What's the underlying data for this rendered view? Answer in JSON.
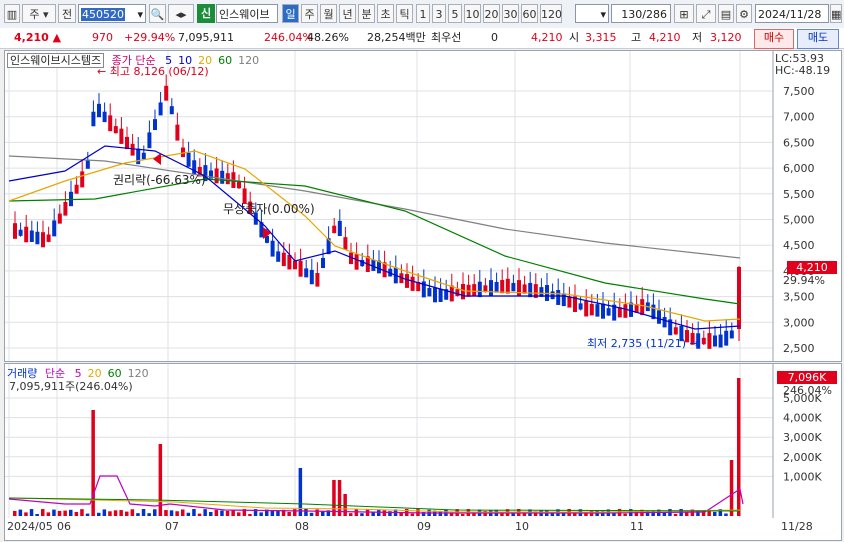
{
  "toolbar": {
    "market_label": "주",
    "scope_label": "전",
    "code": "450520",
    "sin_badge": "신",
    "stock_name": "인스웨이브",
    "periods": [
      "일",
      "주",
      "월",
      "년",
      "분",
      "초",
      "틱"
    ],
    "intervals": [
      "1",
      "3",
      "5",
      "10",
      "20",
      "30",
      "60",
      "120"
    ],
    "count": "130",
    "total": "/286",
    "date": "2024/11/28"
  },
  "quote": {
    "price": "4,210",
    "change": "970",
    "change_pct": "+29.94%",
    "volume": "7,095,911",
    "volume_pct": "246.04%",
    "ratio": "48.26%",
    "amount": "28,254백만",
    "type": "최우선",
    "zero": "0",
    "best": "4,210",
    "open_label": "시",
    "open": "3,315",
    "high_label": "고",
    "high": "4,210",
    "low_label": "저",
    "low": "3,120",
    "buy_label": "매수",
    "sell_label": "매도"
  },
  "price_panel": {
    "title": "인스웨이브시스템즈",
    "ma_label": "종가 단순",
    "ma_periods": [
      {
        "p": "5",
        "color": "#0000cc"
      },
      {
        "p": "10",
        "color": "#0000cc"
      },
      {
        "p": "20",
        "color": "#e6a800"
      },
      {
        "p": "60",
        "color": "#008000"
      },
      {
        "p": "120",
        "color": "#808080"
      }
    ],
    "lc": "LC:53.93",
    "hc": "HC:-48.19",
    "y_ticks": [
      "7,500",
      "7,000",
      "6,500",
      "6,000",
      "5,500",
      "5,000",
      "4,500",
      "4,000",
      "3,500",
      "3,000",
      "2,500"
    ],
    "current_price": "4,210",
    "current_pct": "29.94%",
    "annotations": {
      "high": "최고 8,126 (06/12)",
      "rights": "권리락(-66.63%)",
      "free_issue": "무상증자(0.00%)",
      "low": "최저 2,735 (11/21)"
    }
  },
  "volume_panel": {
    "title": "거래량",
    "ma_label": "단순",
    "ma_periods": [
      {
        "p": "5",
        "color": "#c000c0"
      },
      {
        "p": "20",
        "color": "#e6a800"
      },
      {
        "p": "60",
        "color": "#008000"
      },
      {
        "p": "120",
        "color": "#808080"
      }
    ],
    "value_line": "7,095,911주(246.04%)",
    "current": "7,096K",
    "current_pct": "246.04%",
    "y_ticks": [
      "5,000K",
      "4,000K",
      "3,000K",
      "2,000K",
      "1,000K"
    ]
  },
  "x_axis": {
    "labels": [
      "2024/05",
      "06",
      "07",
      "08",
      "09",
      "10",
      "11"
    ],
    "end_label": "11/28"
  },
  "colors": {
    "up": "#e0001b",
    "down": "#0033cc"
  }
}
